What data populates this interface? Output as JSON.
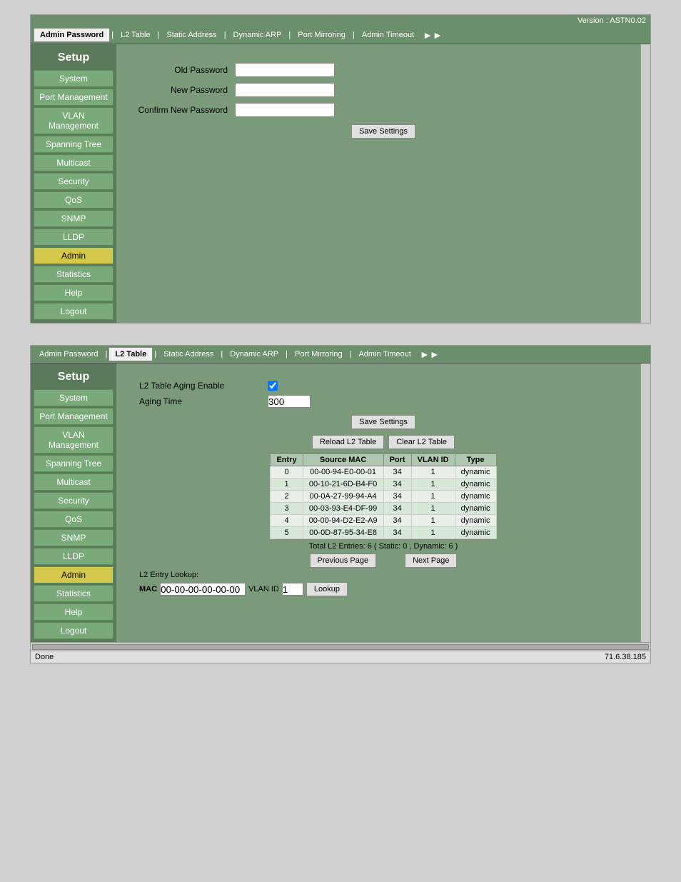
{
  "version": "Version : ASTN0.02",
  "panel1": {
    "title": "Setup",
    "tabs": [
      {
        "label": "Admin Password",
        "active": true
      },
      {
        "label": "L2 Table"
      },
      {
        "label": "Static Address"
      },
      {
        "label": "Dynamic ARP"
      },
      {
        "label": "Port Mirroring"
      },
      {
        "label": "Admin Timeout"
      }
    ],
    "sidebar": [
      {
        "label": "System"
      },
      {
        "label": "Port Management"
      },
      {
        "label": "VLAN Management"
      },
      {
        "label": "Spanning Tree"
      },
      {
        "label": "Multicast"
      },
      {
        "label": "Security"
      },
      {
        "label": "QoS"
      },
      {
        "label": "SNMP"
      },
      {
        "label": "LLDP"
      },
      {
        "label": "Admin",
        "active": true
      },
      {
        "label": "Statistics"
      },
      {
        "label": "Help"
      },
      {
        "label": "Logout"
      }
    ],
    "form": {
      "old_password_label": "Old Password",
      "new_password_label": "New Password",
      "confirm_password_label": "Confirm New Password",
      "save_button": "Save Settings"
    }
  },
  "panel2": {
    "title": "Setup",
    "tabs": [
      {
        "label": "Admin Password"
      },
      {
        "label": "L2 Table",
        "active": true
      },
      {
        "label": "Static Address"
      },
      {
        "label": "Dynamic ARP"
      },
      {
        "label": "Port Mirroring"
      },
      {
        "label": "Admin Timeout"
      }
    ],
    "sidebar": [
      {
        "label": "System"
      },
      {
        "label": "Port Management"
      },
      {
        "label": "VLAN Management"
      },
      {
        "label": "Spanning Tree"
      },
      {
        "label": "Multicast"
      },
      {
        "label": "Security"
      },
      {
        "label": "QoS"
      },
      {
        "label": "SNMP"
      },
      {
        "label": "LLDP"
      },
      {
        "label": "Admin",
        "active": true
      },
      {
        "label": "Statistics"
      },
      {
        "label": "Help"
      },
      {
        "label": "Logout"
      }
    ],
    "l2_aging_enable_label": "L2 Table Aging Enable",
    "aging_time_label": "Aging Time",
    "aging_time_value": "300",
    "save_button": "Save Settings",
    "reload_button": "Reload L2 Table",
    "clear_button": "Clear L2 Table",
    "table": {
      "headers": [
        "Entry",
        "Source MAC",
        "Port",
        "VLAN ID",
        "Type"
      ],
      "rows": [
        {
          "entry": "0",
          "mac": "00-00-94-E0-00-01",
          "port": "34",
          "vlan": "1",
          "type": "dynamic"
        },
        {
          "entry": "1",
          "mac": "00-10-21-6D-B4-F0",
          "port": "34",
          "vlan": "1",
          "type": "dynamic"
        },
        {
          "entry": "2",
          "mac": "00-0A-27-99-94-A4",
          "port": "34",
          "vlan": "1",
          "type": "dynamic"
        },
        {
          "entry": "3",
          "mac": "00-03-93-E4-DF-99",
          "port": "34",
          "vlan": "1",
          "type": "dynamic"
        },
        {
          "entry": "4",
          "mac": "00-00-94-D2-E2-A9",
          "port": "34",
          "vlan": "1",
          "type": "dynamic"
        },
        {
          "entry": "5",
          "mac": "00-0D-87-95-34-E8",
          "port": "34",
          "vlan": "1",
          "type": "dynamic"
        }
      ]
    },
    "total_entries": "Total L2 Entries: 6  ( Static: 0 , Dynamic: 6 )",
    "prev_page_btn": "Previous Page",
    "next_page_btn": "Next Page",
    "lookup_label": "L2 Entry Lookup:",
    "mac_label": "MAC",
    "mac_default": "00-00-00-00-00-00",
    "vlan_label": "VLAN ID",
    "vlan_default": "1",
    "lookup_btn": "Lookup"
  },
  "status_bar": {
    "left": "Done",
    "right": "71.6.38.185"
  }
}
